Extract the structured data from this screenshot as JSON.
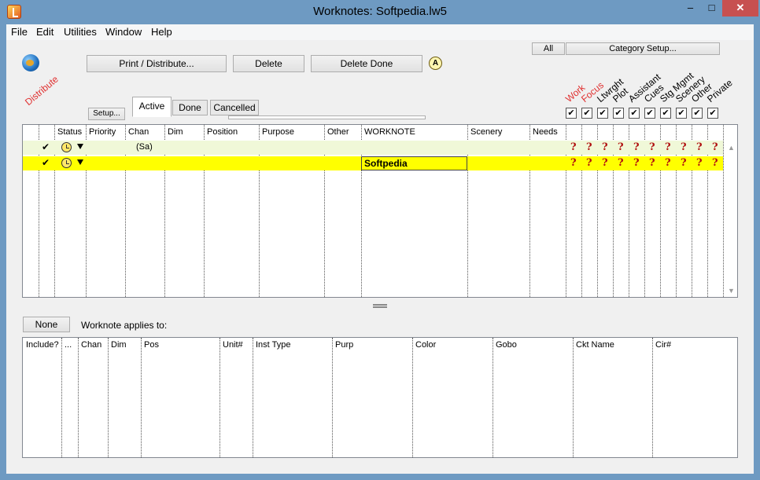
{
  "window": {
    "title": "Worknotes: Softpedia.lw5",
    "minimize": "–",
    "maximize": "□",
    "close": "✕"
  },
  "menu": [
    "File",
    "Edit",
    "Utilities",
    "Window",
    "Help"
  ],
  "toolbar": {
    "print": "Print / Distribute...",
    "delete": "Delete",
    "delete_done": "Delete Done",
    "all": "All",
    "category_setup": "Category Setup...",
    "a_icon": "A",
    "distribute": "Distribute",
    "setup": "Setup..."
  },
  "tabs": [
    "Active",
    "Done",
    "Cancelled"
  ],
  "categories": [
    {
      "label": "Work",
      "red": true,
      "checked": "✔"
    },
    {
      "label": "Focus",
      "red": true,
      "checked": "✔"
    },
    {
      "label": "Ltwrght",
      "red": false,
      "checked": "✔"
    },
    {
      "label": "Plot",
      "red": false,
      "checked": "✔"
    },
    {
      "label": "Assistant",
      "red": false,
      "checked": "✔"
    },
    {
      "label": "Cues",
      "red": false,
      "checked": "✔"
    },
    {
      "label": "Stg Mgmt",
      "red": false,
      "checked": "✔"
    },
    {
      "label": "Scenery",
      "red": false,
      "checked": "✔"
    },
    {
      "label": "Other",
      "red": false,
      "checked": "✔"
    },
    {
      "label": "Private",
      "red": false,
      "checked": "✔"
    }
  ],
  "worknotes": {
    "columns": [
      "Status",
      "Priority",
      "Chan",
      "Dim",
      "Position",
      "Purpose",
      "Other",
      "WORKNOTE",
      "Scenery",
      "Needs"
    ],
    "rows": [
      {
        "check": "✔",
        "chan": "(Sa)",
        "worknote": "",
        "selected": false
      },
      {
        "check": "✔",
        "chan": "",
        "worknote": "Softpedia",
        "selected": true
      }
    ],
    "qmark": "?"
  },
  "applies": {
    "none": "None",
    "label": "Worknote applies to:",
    "columns": [
      "Include?",
      "...",
      "Chan",
      "Dim",
      "Pos",
      "Unit#",
      "Inst Type",
      "Purp",
      "Color",
      "Gobo",
      "Ckt Name",
      "Cir#"
    ]
  },
  "colors": {
    "row_light": "#f0f8d8",
    "row_selected": "#ffff00",
    "accent_red": "#e03030"
  },
  "icons": [
    "app-icon",
    "globe-icon",
    "auto-icon",
    "status-clock-icon",
    "dropdown-arrow-icon",
    "checkmark-icon",
    "question-icon"
  ]
}
